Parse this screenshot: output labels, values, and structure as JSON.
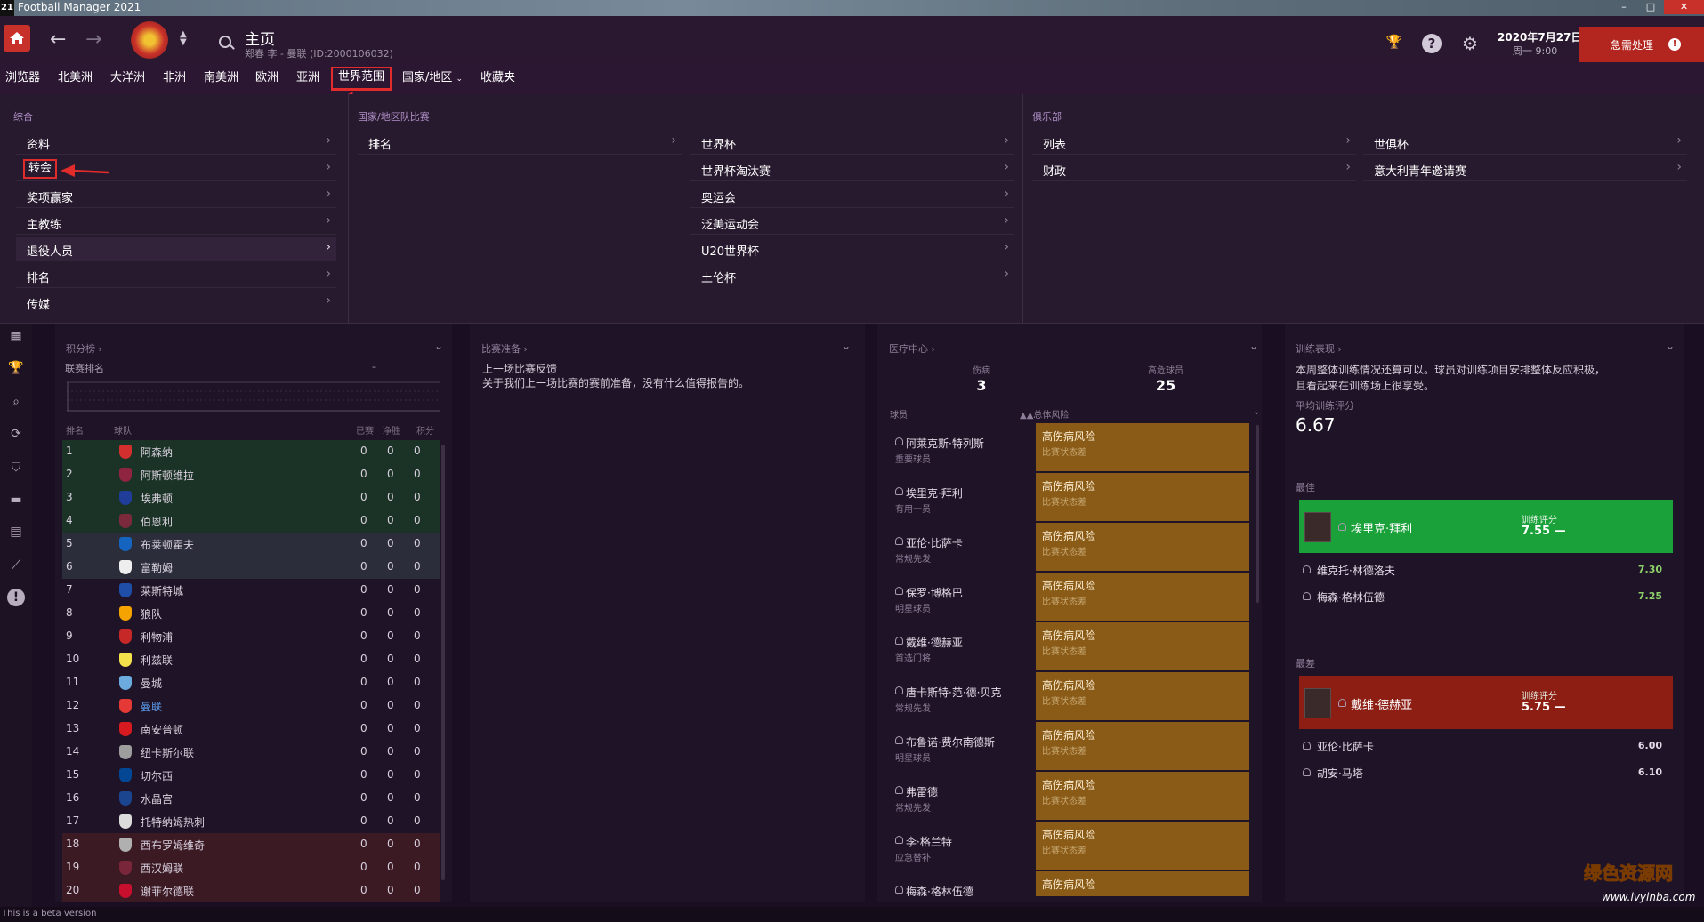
{
  "window": {
    "title": "Football Manager 2021",
    "app_icon": "21"
  },
  "header": {
    "title": "主页",
    "subtitle": "郑春 李 - 曼联 (ID:2000106032)",
    "date": "2020年7月27日",
    "time": "周一 9:00",
    "urgent_label": "急需处理",
    "alert_glyph": "!"
  },
  "tabs": [
    {
      "label": "浏览器"
    },
    {
      "label": "北美洲"
    },
    {
      "label": "大洋洲"
    },
    {
      "label": "非洲"
    },
    {
      "label": "南美洲"
    },
    {
      "label": "欧洲"
    },
    {
      "label": "亚洲"
    },
    {
      "label": "世界范围"
    },
    {
      "label": "国家/地区"
    },
    {
      "label": "收藏夹"
    }
  ],
  "dropdown": {
    "general": {
      "heading": "综合",
      "items": [
        "资料",
        "转会",
        "奖项赢家",
        "主教练",
        "退役人员",
        "排名",
        "传媒"
      ]
    },
    "national": {
      "heading": "国家/地区队比赛",
      "items_col1": [
        "排名"
      ],
      "items_col2": [
        "世界杯",
        "世界杯淘汰赛",
        "奥运会",
        "泛美运动会",
        "U20世界杯",
        "土伦杯"
      ]
    },
    "clubs": {
      "heading": "俱乐部",
      "items_col1": [
        "列表",
        "财政"
      ],
      "items_col2": [
        "世俱杯",
        "意大利青年邀请赛"
      ]
    }
  },
  "standings": {
    "title": "积分榜",
    "league_rank_label": "联赛排名",
    "league_rank_value": "-",
    "headers": {
      "pos": "排名",
      "team": "球队",
      "played": "已赛",
      "gd": "净胜",
      "pts": "积分"
    },
    "rows": [
      {
        "pos": "1",
        "team": "阿森纳",
        "p": "0",
        "gd": "0",
        "pts": "0",
        "zone": "cl",
        "color": "#d32f2f"
      },
      {
        "pos": "2",
        "team": "阿斯顿维拉",
        "p": "0",
        "gd": "0",
        "pts": "0",
        "zone": "cl",
        "color": "#8e2440"
      },
      {
        "pos": "3",
        "team": "埃弗顿",
        "p": "0",
        "gd": "0",
        "pts": "0",
        "zone": "cl",
        "color": "#1f3d99"
      },
      {
        "pos": "4",
        "team": "伯恩利",
        "p": "0",
        "gd": "0",
        "pts": "0",
        "zone": "cl",
        "color": "#7a2a3a"
      },
      {
        "pos": "5",
        "team": "布莱顿霍夫",
        "p": "0",
        "gd": "0",
        "pts": "0",
        "zone": "el",
        "color": "#1565c0"
      },
      {
        "pos": "6",
        "team": "富勒姆",
        "p": "0",
        "gd": "0",
        "pts": "0",
        "zone": "el",
        "color": "#eeeeee"
      },
      {
        "pos": "7",
        "team": "莱斯特城",
        "p": "0",
        "gd": "0",
        "pts": "0",
        "zone": "",
        "color": "#1e4ea8"
      },
      {
        "pos": "8",
        "team": "狼队",
        "p": "0",
        "gd": "0",
        "pts": "0",
        "zone": "",
        "color": "#f4a300"
      },
      {
        "pos": "9",
        "team": "利物浦",
        "p": "0",
        "gd": "0",
        "pts": "0",
        "zone": "",
        "color": "#c62828"
      },
      {
        "pos": "10",
        "team": "利兹联",
        "p": "0",
        "gd": "0",
        "pts": "0",
        "zone": "",
        "color": "#f2e14a"
      },
      {
        "pos": "11",
        "team": "曼城",
        "p": "0",
        "gd": "0",
        "pts": "0",
        "zone": "",
        "color": "#6cabdd"
      },
      {
        "pos": "12",
        "team": "曼联",
        "p": "0",
        "gd": "0",
        "pts": "0",
        "zone": "",
        "color": "#e53935",
        "mine": true
      },
      {
        "pos": "13",
        "team": "南安普顿",
        "p": "0",
        "gd": "0",
        "pts": "0",
        "zone": "",
        "color": "#d71920"
      },
      {
        "pos": "14",
        "team": "纽卡斯尔联",
        "p": "0",
        "gd": "0",
        "pts": "0",
        "zone": "",
        "color": "#9e9e9e"
      },
      {
        "pos": "15",
        "team": "切尔西",
        "p": "0",
        "gd": "0",
        "pts": "0",
        "zone": "",
        "color": "#034694"
      },
      {
        "pos": "16",
        "team": "水晶宫",
        "p": "0",
        "gd": "0",
        "pts": "0",
        "zone": "",
        "color": "#1b458f"
      },
      {
        "pos": "17",
        "team": "托特纳姆热刺",
        "p": "0",
        "gd": "0",
        "pts": "0",
        "zone": "",
        "color": "#dcdcdc"
      },
      {
        "pos": "18",
        "team": "西布罗姆维奇",
        "p": "0",
        "gd": "0",
        "pts": "0",
        "zone": "rel",
        "color": "#b0b0b0"
      },
      {
        "pos": "19",
        "team": "西汉姆联",
        "p": "0",
        "gd": "0",
        "pts": "0",
        "zone": "rel",
        "color": "#7a263a"
      },
      {
        "pos": "20",
        "team": "谢菲尔德联",
        "p": "0",
        "gd": "0",
        "pts": "0",
        "zone": "rel",
        "color": "#c8102e"
      }
    ]
  },
  "match_prep": {
    "title": "比赛准备",
    "line1": "上一场比赛反馈",
    "line2": "关于我们上一场比赛的赛前准备，没有什么值得报告的。"
  },
  "medical": {
    "title": "医疗中心",
    "injured_label": "伤病",
    "injured_value": "3",
    "risk_label": "高危球员",
    "risk_value": "25",
    "col_player": "球员",
    "col_risk": "总体风险",
    "rows": [
      {
        "name": "阿莱克斯·特列斯",
        "role": "重要球员",
        "risk": "高伤病风险",
        "status": "比赛状态差"
      },
      {
        "name": "埃里克·拜利",
        "role": "有用一员",
        "risk": "高伤病风险",
        "status": "比赛状态差"
      },
      {
        "name": "亚伦·比萨卡",
        "role": "常规先发",
        "risk": "高伤病风险",
        "status": "比赛状态差"
      },
      {
        "name": "保罗·博格巴",
        "role": "明星球员",
        "risk": "高伤病风险",
        "status": "比赛状态差"
      },
      {
        "name": "戴维·德赫亚",
        "role": "首选门将",
        "risk": "高伤病风险",
        "status": "比赛状态差"
      },
      {
        "name": "唐卡斯特·范·德·贝克",
        "role": "常规先发",
        "risk": "高伤病风险",
        "status": "比赛状态差"
      },
      {
        "name": "布鲁诺·费尔南德斯",
        "role": "明星球员",
        "risk": "高伤病风险",
        "status": "比赛状态差"
      },
      {
        "name": "弗雷德",
        "role": "常规先发",
        "risk": "高伤病风险",
        "status": "比赛状态差"
      },
      {
        "name": "李·格兰特",
        "role": "应急替补",
        "risk": "高伤病风险",
        "status": "比赛状态差"
      },
      {
        "name": "梅森·格林伍德",
        "role": "",
        "risk": "高伤病风险",
        "status": ""
      }
    ]
  },
  "training": {
    "title": "训练表现",
    "desc1": "本周整体训练情况还算可以。球员对训练项目安排整体反应积极，",
    "desc2": "且看起来在训练场上很享受。",
    "avg_label": "平均训练评分",
    "avg_value": "6.67",
    "best_label": "最佳",
    "worst_label": "最差",
    "rating_label": "训练评分",
    "trend": "—",
    "best_card": {
      "name": "埃里克·拜利",
      "rating": "7.55"
    },
    "best_rows": [
      {
        "name": "维克托·林德洛夫",
        "rating": "7.30"
      },
      {
        "name": "梅森·格林伍德",
        "rating": "7.25"
      }
    ],
    "worst_card": {
      "name": "戴维·德赫亚",
      "rating": "5.75"
    },
    "worst_rows": [
      {
        "name": "亚伦·比萨卡",
        "rating": "6.00"
      },
      {
        "name": "胡安·马塔",
        "rating": "6.10"
      }
    ]
  },
  "footer": {
    "beta": "This is a beta version"
  },
  "watermark": {
    "line1": "绿色资源网",
    "line2": "www.lvyinba.com"
  },
  "colors": {
    "accent": "#e22b2b",
    "good": "#1aa13a",
    "bad": "#8c1e14",
    "risk": "#8a5a17"
  }
}
